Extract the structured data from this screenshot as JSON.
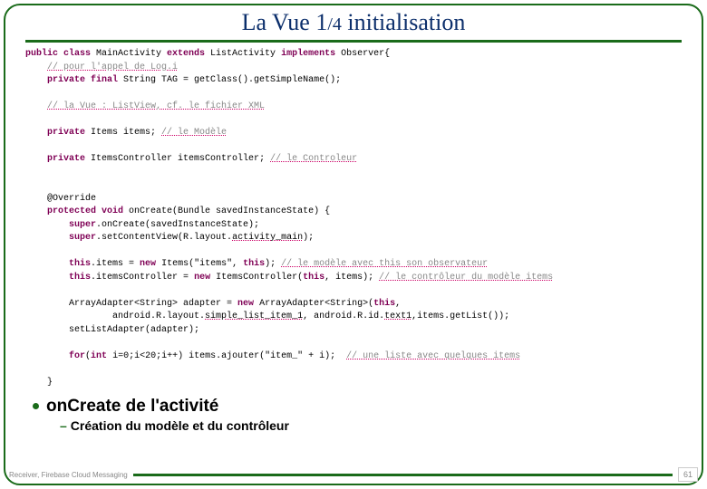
{
  "title": {
    "pre": "La Vue 1",
    "suf": "/4",
    "post": " initialisation"
  },
  "code": {
    "l1p": "public class",
    "l1a": " MainActivity ",
    "l1b": "extends",
    "l1c": " ListActivity ",
    "l1d": "implements",
    "l1e": " Observer{",
    "l2a": "    ",
    "l2cm": "// pour l'appel de Log.i",
    "l3a": "    ",
    "l3b": "private final",
    "l3c": " String TAG = getClass().getSimpleName();",
    "l5a": "    ",
    "l5cm": "// la Vue : ListView, cf. le fichier XML",
    "l7a": "    ",
    "l7b": "private",
    "l7c": " Items items; ",
    "l7cm": "// le Modèle",
    "l9a": "    ",
    "l9b": "private",
    "l9c": " ItemsController itemsController; ",
    "l9cm": "// le Controleur",
    "l12a": "    @Override",
    "l13a": "    ",
    "l13b": "protected void",
    "l13c": " onCreate(Bundle savedInstanceState) {",
    "l14a": "        ",
    "l14b": "super",
    "l14c": ".onCreate(savedInstanceState);",
    "l15a": "        ",
    "l15b": "super",
    "l15c": ".setContentView(R.layout.",
    "l15d": "activity_main",
    "l15e": ");",
    "l17a": "        ",
    "l17b": "this",
    "l17c": ".items = ",
    "l17d": "new",
    "l17e": " Items(\"items\", ",
    "l17f": "this",
    "l17g": "); ",
    "l17cm": "// le modèle avec this son observateur",
    "l18a": "        ",
    "l18b": "this",
    "l18c": ".itemsController = ",
    "l18d": "new",
    "l18e": " ItemsController(",
    "l18f": "this",
    "l18g": ", items); ",
    "l18cm": "// le contrôleur du modèle items",
    "l20a": "        ArrayAdapter<String> adapter = ",
    "l20b": "new",
    "l20c": " ArrayAdapter<String>(",
    "l20d": "this",
    "l20e": ",",
    "l21a": "                android.R.layout.",
    "l21b": "simple_list_item_1",
    "l21c": ", android.R.id.",
    "l21d": "text1",
    "l21e": ",items.getList());",
    "l22a": "        setListAdapter(adapter);",
    "l24a": "        ",
    "l24b": "for",
    "l24c": "(",
    "l24d": "int",
    "l24e": " i=0;i<20;i++) items.ajouter(\"item_\" + i);  ",
    "l24cm": "// une liste avec quelques items",
    "l26a": "    }"
  },
  "bullets": {
    "lvl1": "onCreate de l'activité",
    "lvl2": "Création du modèle et du contrôleur"
  },
  "footer": {
    "text": "Receiver, Firebase Cloud Messaging",
    "page": "61"
  }
}
